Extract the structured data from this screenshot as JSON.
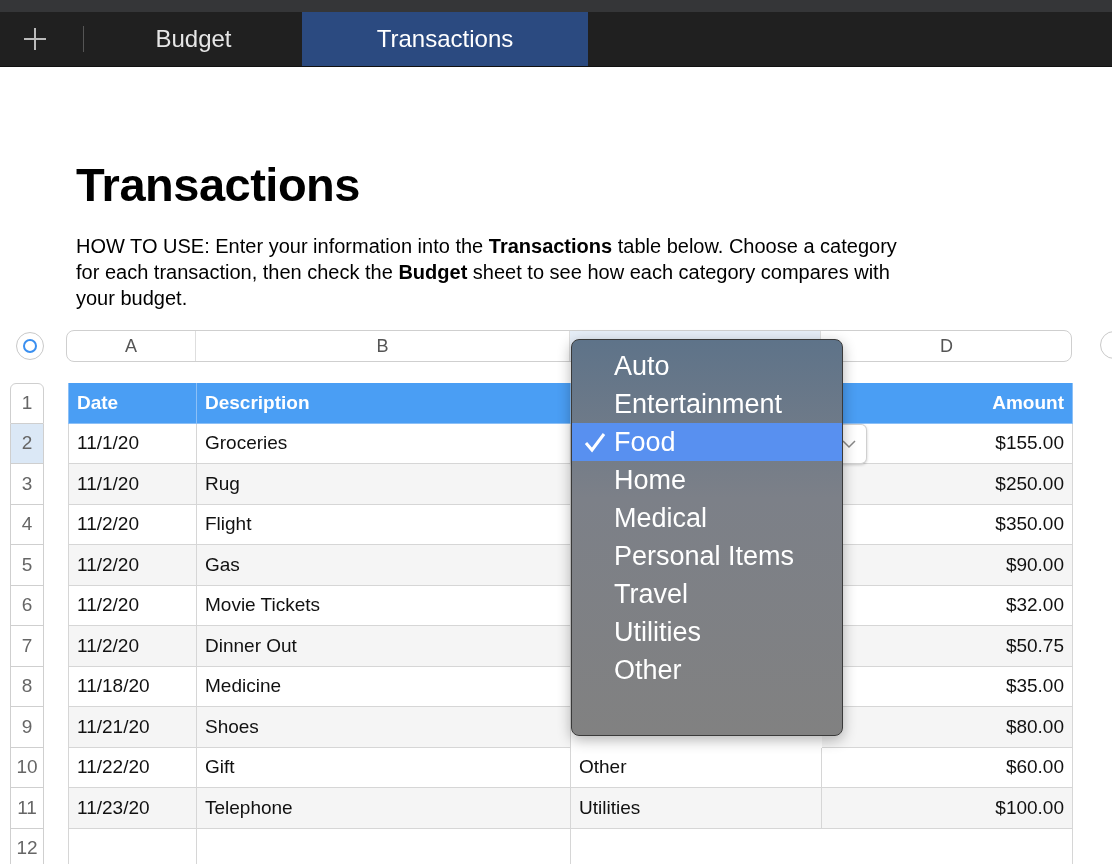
{
  "tabs": [
    {
      "label": "Budget",
      "selected": false
    },
    {
      "label": "Transactions",
      "selected": true
    }
  ],
  "title": "Transactions",
  "instructions": "HOW TO USE: Enter your information into the **Transactions** table below. Choose a category for each transaction, then check the **Budget** sheet to see how each category compares with your budget.",
  "column_letters": {
    "a": "A",
    "b": "B",
    "d": "D"
  },
  "header": {
    "number": "1",
    "date": "Date",
    "description": "Description",
    "amount": "Amount"
  },
  "rows": [
    {
      "number": "2",
      "date": "11/1/20",
      "description": "Groceries",
      "amount": "$155.00",
      "selected": true
    },
    {
      "number": "3",
      "date": "11/1/20",
      "description": "Rug",
      "amount": "$250.00",
      "selected": false
    },
    {
      "number": "4",
      "date": "11/2/20",
      "description": "Flight",
      "amount": "$350.00",
      "selected": false
    },
    {
      "number": "5",
      "date": "11/2/20",
      "description": "Gas",
      "amount": "$90.00",
      "selected": false
    },
    {
      "number": "6",
      "date": "11/2/20",
      "description": "Movie Tickets",
      "amount": "$32.00",
      "selected": false
    },
    {
      "number": "7",
      "date": "11/2/20",
      "description": "Dinner Out",
      "amount": "$50.75",
      "selected": false
    },
    {
      "number": "8",
      "date": "11/18/20",
      "description": "Medicine",
      "amount": "$35.00",
      "selected": false
    },
    {
      "number": "9",
      "date": "11/21/20",
      "description": "Shoes",
      "amount": "$80.00",
      "selected": false
    },
    {
      "number": "10",
      "date": "11/22/20",
      "description": "Gift",
      "category": "Other",
      "amount": "$60.00",
      "selected": false
    },
    {
      "number": "11",
      "date": "11/23/20",
      "description": "Telephone",
      "category": "Utilities",
      "amount": "$100.00",
      "selected": false
    },
    {
      "number": "12",
      "selected": false
    }
  ],
  "category_menu": {
    "items": [
      {
        "label": "Auto",
        "selected": false
      },
      {
        "label": "Entertainment",
        "selected": false
      },
      {
        "label": "Food",
        "selected": true
      },
      {
        "label": "Home",
        "selected": false
      },
      {
        "label": "Medical",
        "selected": false
      },
      {
        "label": "Personal Items",
        "selected": false
      },
      {
        "label": "Travel",
        "selected": false
      },
      {
        "label": "Utilities",
        "selected": false
      },
      {
        "label": "Other",
        "selected": false
      }
    ]
  }
}
